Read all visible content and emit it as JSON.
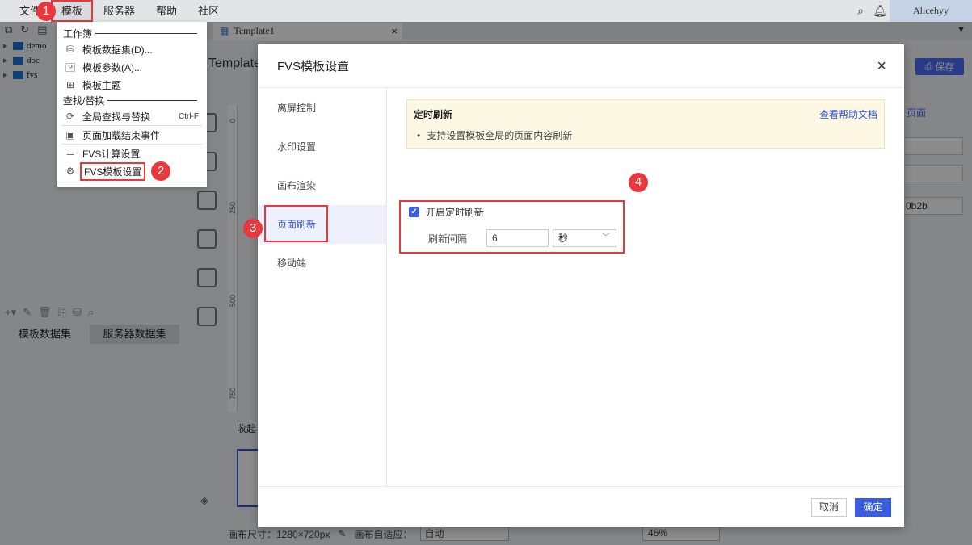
{
  "menubar": {
    "items": [
      "文件",
      "模板",
      "服务器",
      "帮助",
      "社区"
    ],
    "user": "Alicehyy"
  },
  "tree": {
    "items": [
      "demo",
      "doc",
      "fvs"
    ]
  },
  "left_tabs": [
    "模板数据集",
    "服务器数据集"
  ],
  "doc_tab": {
    "title": "Template1",
    "close": "×"
  },
  "template_title": "Template",
  "save_label": "保存",
  "dropdown": {
    "section_workbook": "工作簿",
    "section_find": "查找/替换",
    "items": [
      {
        "label": "模板数据集(D)...",
        "icon": "database-icon"
      },
      {
        "label": "模板参数(A)...",
        "icon": "parameter-icon"
      },
      {
        "label": "模板主题",
        "icon": "theme-icon"
      },
      {
        "label": "全局查找与替换",
        "shortcut": "Ctrl-F",
        "icon": "search-replace-icon"
      },
      {
        "label": "页面加载结束事件",
        "icon": "event-icon"
      },
      {
        "label": "FVS计算设置",
        "icon": "calc-icon"
      },
      {
        "label": "FVS模板设置",
        "icon": "template-settings-icon"
      }
    ]
  },
  "dialog": {
    "title": "FVS模板设置",
    "close": "×",
    "nav": [
      "离屏控制",
      "水印设置",
      "画布渲染",
      "页面刷新",
      "移动端"
    ],
    "active_nav": "页面刷新",
    "notice": {
      "title": "定时刷新",
      "link": "查看帮助文档",
      "desc": "支持设置模板全局的页面内容刷新"
    },
    "enable_label": "开启定时刷新",
    "enable_checked": true,
    "interval_label": "刷新间隔",
    "interval_value": "6",
    "interval_unit": "秒",
    "cancel": "取消",
    "ok": "确定"
  },
  "footer": {
    "canvas_size": "画布尺寸：1280×720px",
    "adapt_label": "画布自适应：",
    "adapt_value": "自动",
    "zoom": "46%"
  },
  "right_pane": {
    "label": "页面",
    "value3": "0b2b"
  },
  "canvas": {
    "collapse": "收起"
  },
  "ruler": [
    "0",
    "250",
    "500",
    "750"
  ],
  "steps": [
    "1",
    "2",
    "3",
    "4"
  ],
  "colors": {
    "accent": "#3a5ce0",
    "highlight": "#e8383d",
    "notice_bg": "#fdf8e4"
  }
}
